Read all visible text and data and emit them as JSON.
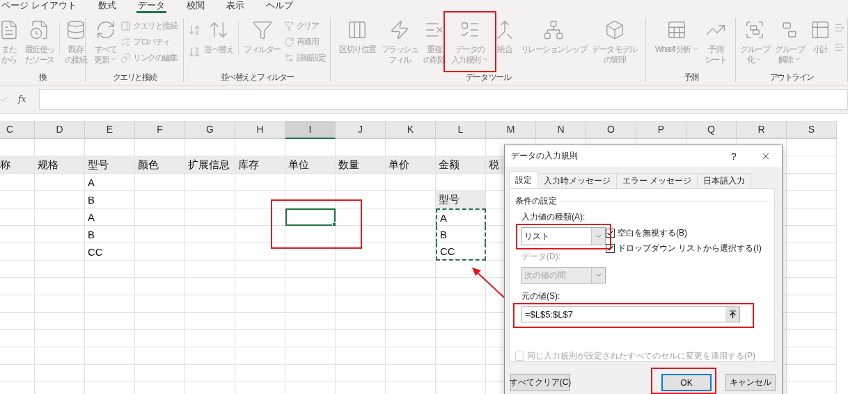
{
  "ribbon": {
    "tabs": [
      {
        "label": "ページ レイアウト",
        "selected": false
      },
      {
        "label": "数式",
        "selected": false
      },
      {
        "label": "データ",
        "selected": true
      },
      {
        "label": "校閲",
        "selected": false
      },
      {
        "label": "表示",
        "selected": false
      },
      {
        "label": "ヘルプ",
        "selected": false
      }
    ],
    "groups": [
      {
        "label": "換",
        "items": [
          {
            "kind": "large",
            "label": "またから",
            "menu": false,
            "highlighted": false
          },
          {
            "kind": "large",
            "label": "最近使ったソース",
            "menu": false,
            "highlighted": false
          },
          {
            "kind": "separator"
          },
          {
            "kind": "large",
            "label": "既存の接続",
            "menu": false,
            "highlighted": false
          }
        ]
      },
      {
        "label": "クエリと接続",
        "items": [
          {
            "kind": "large",
            "label": "すべて更新",
            "menu": true,
            "highlighted": false
          },
          {
            "kind": "stack",
            "entries": [
              "クエリと接続",
              "プロパティ",
              "リンクの編集"
            ]
          }
        ]
      },
      {
        "label": "並べ替えとフィルター",
        "items": [
          {
            "kind": "sort_pair"
          },
          {
            "kind": "large",
            "label": "並べ替え",
            "menu": false,
            "highlighted": false
          },
          {
            "kind": "separator"
          },
          {
            "kind": "large",
            "label": "フィルター",
            "menu": false,
            "highlighted": false
          },
          {
            "kind": "stack",
            "entries": [
              "クリア",
              "再適用",
              "詳細設定"
            ]
          }
        ]
      },
      {
        "label": "データ ツール",
        "items": [
          {
            "kind": "large",
            "label": "区切り位置",
            "menu": false,
            "highlighted": false
          },
          {
            "kind": "large",
            "label": "フラッシュフィル",
            "menu": false,
            "highlighted": false
          },
          {
            "kind": "large",
            "label": "重複の削除",
            "menu": false,
            "highlighted": false
          },
          {
            "kind": "large",
            "label": "データの入力規則",
            "menu": true,
            "highlighted": true
          },
          {
            "kind": "large",
            "label": "統合",
            "menu": false,
            "highlighted": false
          },
          {
            "kind": "large",
            "label": "リレーションシップ",
            "menu": false,
            "highlighted": false
          },
          {
            "kind": "large",
            "label": "データ モデルの管理",
            "menu": false,
            "highlighted": false
          }
        ]
      },
      {
        "label": "予測",
        "items": [
          {
            "kind": "large",
            "label": "What-If 分析",
            "menu": true,
            "highlighted": false
          },
          {
            "kind": "large",
            "label": "予測シート",
            "menu": false,
            "highlighted": false
          }
        ]
      },
      {
        "label": "アウトライン",
        "items": [
          {
            "kind": "large",
            "label": "グループ化",
            "menu": true,
            "highlighted": false
          },
          {
            "kind": "large",
            "label": "グループ解除",
            "menu": true,
            "highlighted": false
          },
          {
            "kind": "large",
            "label": "小計",
            "menu": false,
            "highlighted": false
          },
          {
            "kind": "icon_stack"
          }
        ]
      }
    ]
  },
  "formula_bar": {
    "function_label": "fx"
  },
  "sheet": {
    "columns": [
      {
        "label": "C",
        "selected": false,
        "marquee": false
      },
      {
        "label": "D",
        "selected": false,
        "marquee": false
      },
      {
        "label": "E",
        "selected": false,
        "marquee": false
      },
      {
        "label": "F",
        "selected": false,
        "marquee": false
      },
      {
        "label": "G",
        "selected": false,
        "marquee": false
      },
      {
        "label": "H",
        "selected": false,
        "marquee": false
      },
      {
        "label": "I",
        "selected": true,
        "marquee": false
      },
      {
        "label": "J",
        "selected": false,
        "marquee": false
      },
      {
        "label": "K",
        "selected": false,
        "marquee": false
      },
      {
        "label": "L",
        "selected": false,
        "marquee": true
      },
      {
        "label": "M",
        "selected": false,
        "marquee": false
      },
      {
        "label": "N",
        "selected": false,
        "marquee": false
      },
      {
        "label": "O",
        "selected": false,
        "marquee": false
      },
      {
        "label": "P",
        "selected": false,
        "marquee": false
      },
      {
        "label": "Q",
        "selected": false,
        "marquee": false
      },
      {
        "label": "R",
        "selected": false,
        "marquee": false
      },
      {
        "label": "S",
        "selected": false,
        "marquee": false
      }
    ],
    "highlight_frame": true,
    "rows": [
      {
        "active": false,
        "marquee": false
      },
      {
        "active": false,
        "marquee": false,
        "cells": [
          {
            "text": "称",
            "shaded": true
          },
          {
            "text": "规格",
            "shaded": true
          },
          {
            "text": "型号",
            "shaded": true
          },
          {
            "text": "颜色",
            "shaded": true
          },
          {
            "text": "扩展信息",
            "shaded": true
          },
          {
            "text": "库存",
            "shaded": true
          },
          {
            "text": "单位",
            "shaded": true
          },
          {
            "text": "数量",
            "shaded": true
          },
          {
            "text": "单价",
            "shaded": true
          },
          {
            "text": "金额",
            "shaded": true
          },
          {
            "text": "税",
            "shaded": true
          }
        ]
      },
      {
        "active": false,
        "marquee": false,
        "cells": [
          null,
          null,
          {
            "text": "A",
            "shaded": false
          }
        ]
      },
      {
        "active": false,
        "marquee": false,
        "cells": [
          null,
          null,
          {
            "text": "B",
            "shaded": false
          },
          null,
          null,
          null,
          null,
          null,
          null,
          {
            "text": "型号",
            "shaded": true
          }
        ]
      },
      {
        "active": true,
        "marquee": true,
        "cells": [
          null,
          null,
          {
            "text": "A",
            "shaded": false
          },
          null,
          null,
          null,
          null,
          null,
          null,
          {
            "text": "A",
            "shaded": false
          }
        ]
      },
      {
        "active": false,
        "marquee": true,
        "cells": [
          null,
          null,
          {
            "text": "B",
            "shaded": false
          },
          null,
          null,
          null,
          null,
          null,
          null,
          {
            "text": "B",
            "shaded": false
          }
        ]
      },
      {
        "active": false,
        "marquee": true,
        "cells": [
          null,
          null,
          {
            "text": "CC",
            "shaded": false
          },
          null,
          null,
          null,
          null,
          null,
          null,
          {
            "text": "CC",
            "shaded": false
          }
        ]
      },
      {
        "active": false,
        "marquee": false
      },
      {
        "active": false,
        "marquee": false
      },
      {
        "active": false,
        "marquee": false
      },
      {
        "active": false,
        "marquee": false
      },
      {
        "active": false,
        "marquee": false
      },
      {
        "active": false,
        "marquee": false
      },
      {
        "active": false,
        "marquee": false
      },
      {
        "active": false,
        "marquee": false
      }
    ]
  },
  "pointer_arrow": true,
  "dialog": {
    "title": "データの入力規則",
    "help": "?",
    "tabs": [
      {
        "label": "設定",
        "selected": true
      },
      {
        "label": "入力時メッセージ",
        "selected": false
      },
      {
        "label": "エラー メッセージ",
        "selected": false
      },
      {
        "label": "日本語入力",
        "selected": false
      }
    ],
    "section": "条件の設定",
    "allow": {
      "label": "入力値の種類(A):",
      "value": "リスト",
      "disabled": false,
      "highlighted": true
    },
    "options": [
      {
        "label": "空白を無視する(B)",
        "checked": true,
        "disabled": false
      },
      {
        "label": "ドロップダウン リストから選択する(I)",
        "checked": true,
        "disabled": false
      }
    ],
    "data": {
      "label": "データ(D):",
      "value": "次の値の間",
      "disabled": true,
      "highlighted": false
    },
    "source": {
      "label": "元の値(S):",
      "value": "=$L$5:$L$7",
      "highlighted": true
    },
    "apply_all": {
      "label": "同じ入力規則が設定されたすべてのセルに変更を適用する(P)",
      "checked": false,
      "disabled": true
    },
    "buttons": [
      {
        "label": "すべてクリア(C)",
        "default": false,
        "highlighted": false
      },
      {
        "label": "OK",
        "default": true,
        "highlighted": true
      },
      {
        "label": "キャンセル",
        "default": false,
        "highlighted": false
      }
    ]
  }
}
